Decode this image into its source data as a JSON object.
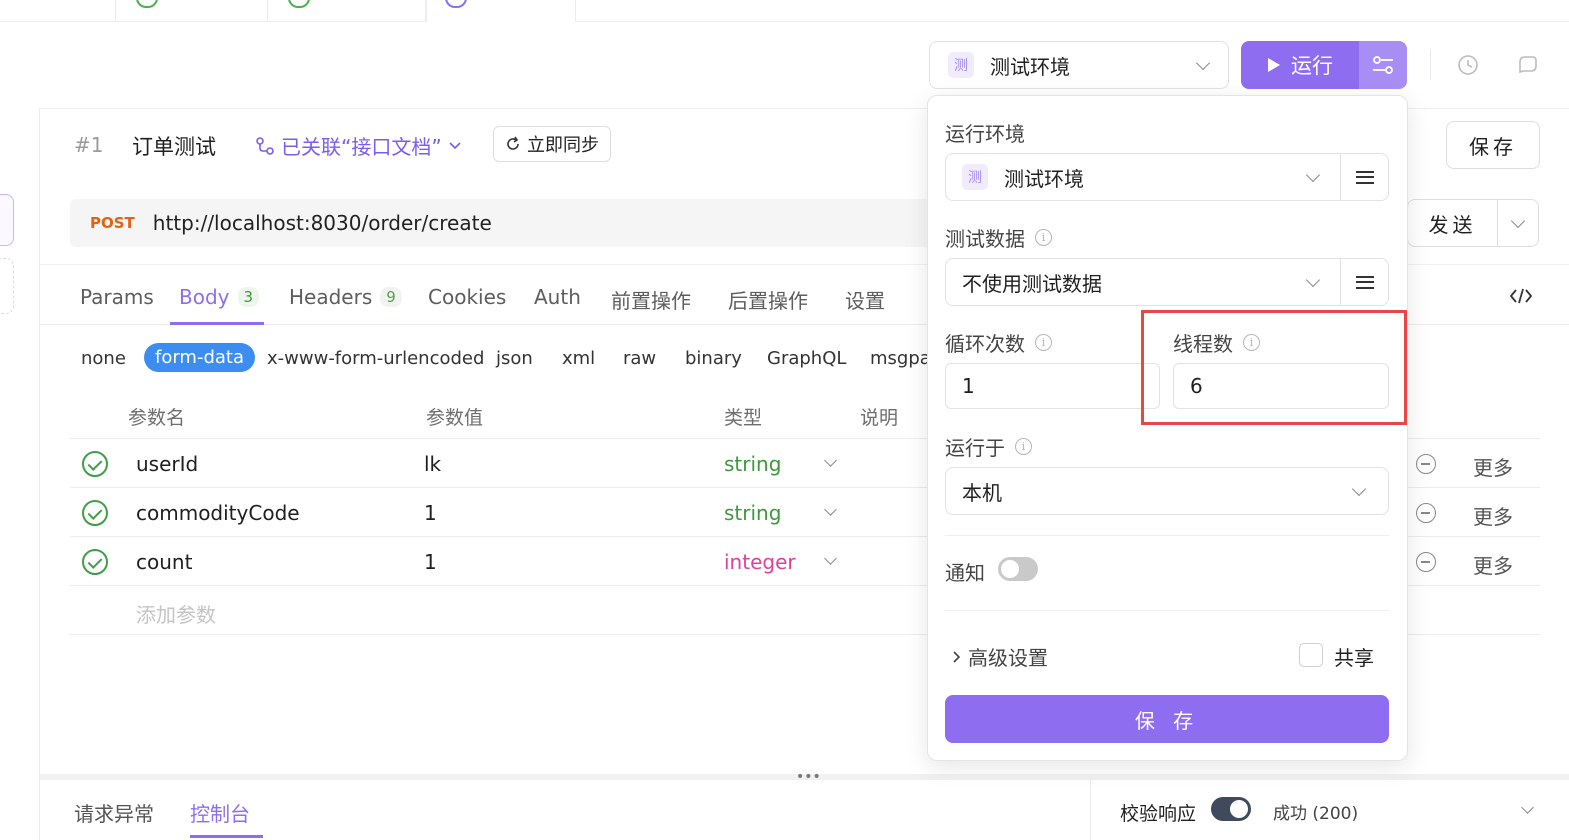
{
  "env": {
    "badge": "测",
    "name": "测试环境"
  },
  "toolbar": {
    "run_label": "运行"
  },
  "request": {
    "hash": "#1",
    "title": "订单测试",
    "linked_label": "已关联“接口文档”",
    "sync_label": "立即同步",
    "save_label": "保存",
    "method": "POST",
    "url": "http://localhost:8030/order/create",
    "send_label": "发送"
  },
  "tabs": [
    {
      "label": "Params",
      "count": ""
    },
    {
      "label": "Body",
      "count": "3"
    },
    {
      "label": "Headers",
      "count": "9"
    },
    {
      "label": "Cookies",
      "count": ""
    },
    {
      "label": "Auth",
      "count": ""
    },
    {
      "label": "前置操作",
      "count": ""
    },
    {
      "label": "后置操作",
      "count": ""
    },
    {
      "label": "设置",
      "count": ""
    }
  ],
  "body_types": [
    "none",
    "form-data",
    "x-www-form-urlencoded",
    "json",
    "xml",
    "raw",
    "binary",
    "GraphQL",
    "msgpac"
  ],
  "table": {
    "headers": [
      "参数名",
      "参数值",
      "类型",
      "说明"
    ],
    "rows": [
      {
        "name": "userId",
        "value": "lk",
        "type": "string"
      },
      {
        "name": "commodityCode",
        "value": "1",
        "type": "string"
      },
      {
        "name": "count",
        "value": "1",
        "type": "integer"
      }
    ],
    "add_placeholder": "添加参数",
    "more_label": "更多"
  },
  "bottom": {
    "tabs": [
      "请求异常",
      "控制台"
    ],
    "validate_label": "校验响应",
    "status": "成功 (200)"
  },
  "run_config": {
    "env_label": "运行环境",
    "env_badge": "测",
    "env_value": "测试环境",
    "data_label": "测试数据",
    "data_value": "不使用测试数据",
    "loop_label": "循环次数",
    "loop_value": "1",
    "threads_label": "线程数",
    "threads_value": "6",
    "run_on_label": "运行于",
    "run_on_value": "本机",
    "notify_label": "通知",
    "advanced_label": "高级设置",
    "share_label": "共享",
    "save_label": "保 存"
  },
  "colors": {
    "accent": "#8e6df0",
    "highlight": "#e84747",
    "method": "#e2620f"
  }
}
